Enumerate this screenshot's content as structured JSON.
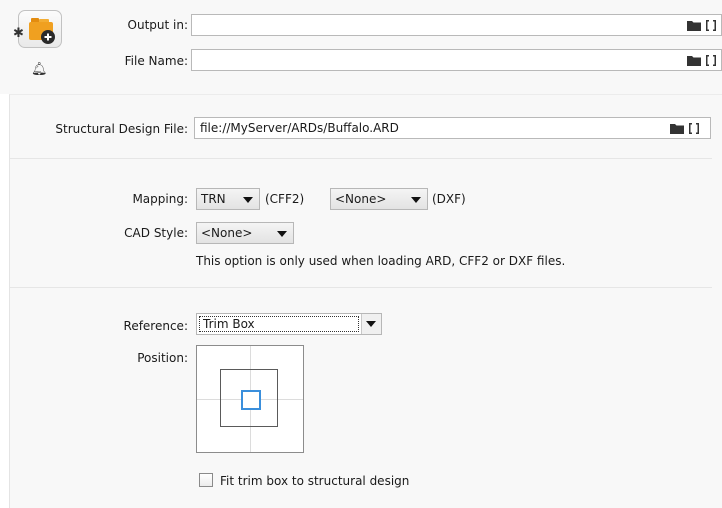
{
  "output": {
    "output_in_label": "Output in:",
    "output_in_value": "",
    "file_name_label": "File Name:",
    "file_name_value": ""
  },
  "structural": {
    "label": "Structural Design File:",
    "value": "file://MyServer/ARDs/Buffalo.ARD"
  },
  "mapping": {
    "label": "Mapping:",
    "cff2_value": "TRN",
    "cff2_suffix": "(CFF2)",
    "dxf_value": "<None>",
    "dxf_suffix": "(DXF)"
  },
  "cad_style": {
    "label": "CAD Style:",
    "value": "<None>",
    "hint": "This option is only used when loading ARD, CFF2 or DXF files."
  },
  "reference": {
    "label": "Reference:",
    "value": "Trim Box"
  },
  "position": {
    "label": "Position:",
    "selected": "center"
  },
  "fit": {
    "label": "Fit trim box to structural design",
    "checked": false
  },
  "icons": [
    "app-icon",
    "bell-icon",
    "folder-icon",
    "bracket-icon",
    "dropdown-arrow-icon"
  ],
  "colors": {
    "accent_blue": "#3a8fdc",
    "icon_orange": "#f0a020",
    "panel_bg": "#f8f8f8"
  }
}
